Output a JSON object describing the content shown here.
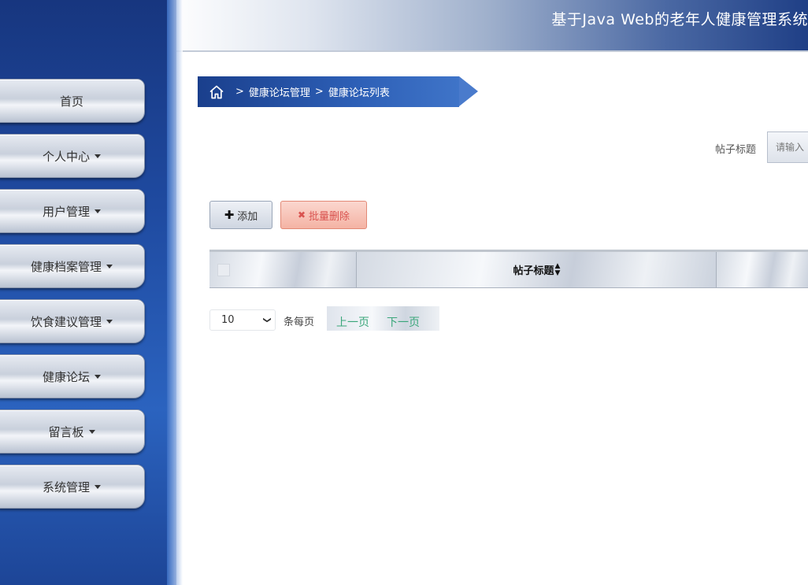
{
  "header": {
    "title": "基于Java Web的老年人健康管理系统"
  },
  "sidebar": {
    "items": [
      {
        "label": "首页",
        "has_caret": false
      },
      {
        "label": "个人中心",
        "has_caret": true
      },
      {
        "label": "用户管理",
        "has_caret": true
      },
      {
        "label": "健康档案管理",
        "has_caret": true
      },
      {
        "label": "饮食建议管理",
        "has_caret": true
      },
      {
        "label": "健康论坛",
        "has_caret": true
      },
      {
        "label": "留言板",
        "has_caret": true
      },
      {
        "label": "系统管理",
        "has_caret": true
      }
    ]
  },
  "breadcrumb": {
    "icon": "home-icon",
    "items": [
      "健康论坛管理",
      "健康论坛列表"
    ],
    "separator": ">"
  },
  "search": {
    "label": "帖子标题",
    "placeholder": "请输入"
  },
  "actions": {
    "add_label": "添加",
    "batch_delete_label": "批量删除"
  },
  "table": {
    "columns": [
      "帖子标题"
    ]
  },
  "pagination": {
    "page_size": "10",
    "per_page_label": "条每页",
    "prev_label": "上一页",
    "next_label": "下一页"
  },
  "colors": {
    "sidebar_bg": "#1f4aa0",
    "breadcrumb_bg": "#2d5fb6",
    "delete_text": "#d9534f",
    "pager_text": "#3aa67a"
  }
}
